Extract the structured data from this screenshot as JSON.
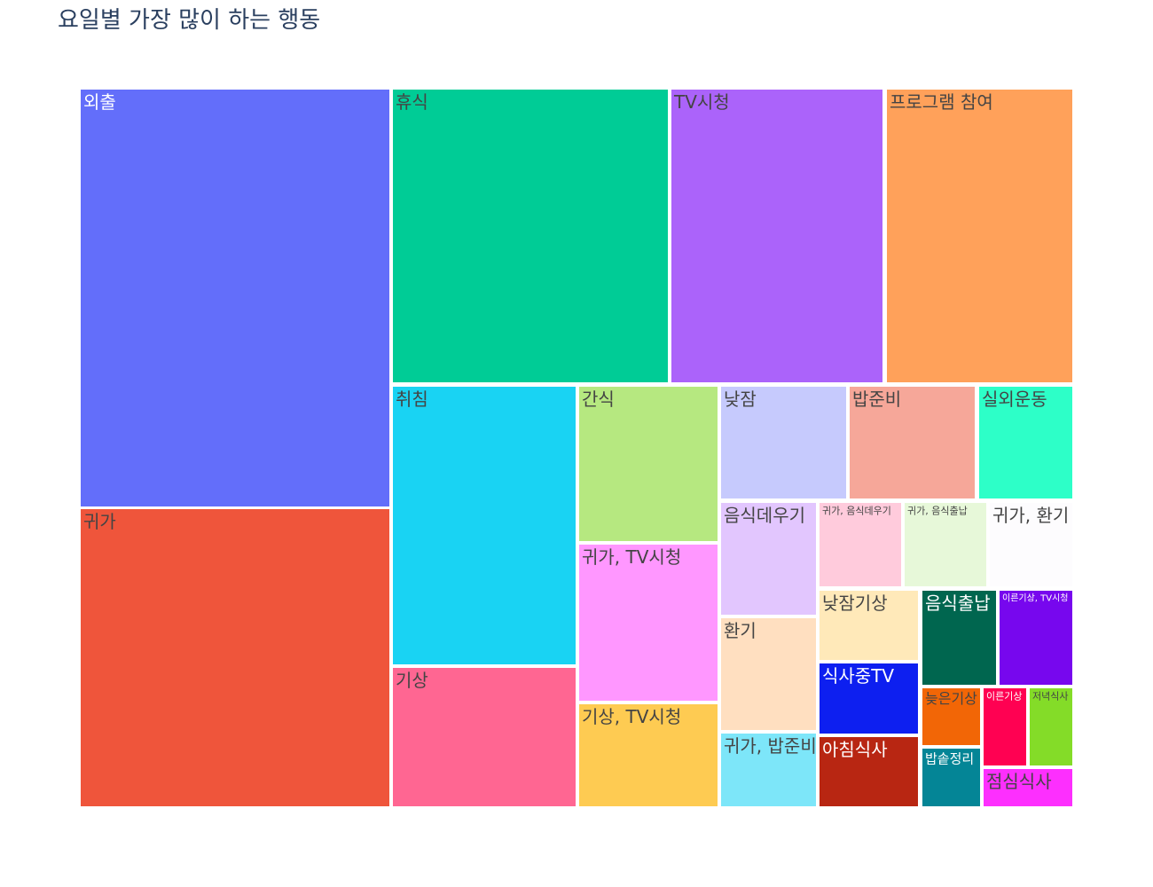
{
  "chart_data": {
    "type": "treemap",
    "title": "요일별 가장 많이 하는 행동",
    "nodes": [
      {
        "label": "외출",
        "color": "#636efa",
        "text_color": "#ffffff"
      },
      {
        "label": "귀가",
        "color": "#ef553b",
        "text_color": "#444444"
      },
      {
        "label": "휴식",
        "color": "#00cc96",
        "text_color": "#444444"
      },
      {
        "label": "TV시청",
        "color": "#ab63fa",
        "text_color": "#444444"
      },
      {
        "label": "프로그램 참여",
        "color": "#ffa15a",
        "text_color": "#444444"
      },
      {
        "label": "취침",
        "color": "#19d3f3",
        "text_color": "#444444"
      },
      {
        "label": "기상",
        "color": "#ff6692",
        "text_color": "#444444"
      },
      {
        "label": "간식",
        "color": "#b6e880",
        "text_color": "#444444"
      },
      {
        "label": "귀가, TV시청",
        "color": "#ff97ff",
        "text_color": "#444444"
      },
      {
        "label": "기상, TV시청",
        "color": "#fecb52",
        "text_color": "#444444"
      },
      {
        "label": "낮잠",
        "color": "#c6cafd",
        "text_color": "#444444"
      },
      {
        "label": "밥준비",
        "color": "#f6a799",
        "text_color": "#444444"
      },
      {
        "label": "실외운동",
        "color": "#2dffc8",
        "text_color": "#444444"
      },
      {
        "label": "음식데우기",
        "color": "#e2c6fe",
        "text_color": "#444444"
      },
      {
        "label": "귀가, 음식데우기",
        "color": "#ffcbdc",
        "text_color": "#444444"
      },
      {
        "label": "귀가, 음식출납",
        "color": "#e7f8d9",
        "text_color": "#444444"
      },
      {
        "label": "귀가, 환기",
        "color": "#fdfcfe",
        "text_color": "#444444"
      },
      {
        "label": "환기",
        "color": "#ffdfc0",
        "text_color": "#444444"
      },
      {
        "label": "귀가, 밥준비",
        "color": "#7de6f9",
        "text_color": "#444444"
      },
      {
        "label": "낮잠기상",
        "color": "#ffe9b9",
        "text_color": "#444444"
      },
      {
        "label": "식사중TV",
        "color": "#0d1ff0",
        "text_color": "#ffffff"
      },
      {
        "label": "아침식사",
        "color": "#b82612",
        "text_color": "#ffffff"
      },
      {
        "label": "음식출납",
        "color": "#00664f",
        "text_color": "#ffffff"
      },
      {
        "label": "이른기상, TV시청",
        "color": "#7707ee",
        "text_color": "#ffffff"
      },
      {
        "label": "늦은기상",
        "color": "#f26606",
        "text_color": "#444444"
      },
      {
        "label": "이른기상",
        "color": "#ff0152",
        "text_color": "#ffffff"
      },
      {
        "label": "저녁식사",
        "color": "#84dc28",
        "text_color": "#444444"
      },
      {
        "label": "밥솥정리",
        "color": "#048596",
        "text_color": "#ffffff"
      },
      {
        "label": "점심식사",
        "color": "#fd2ffe",
        "text_color": "#444444"
      }
    ]
  }
}
